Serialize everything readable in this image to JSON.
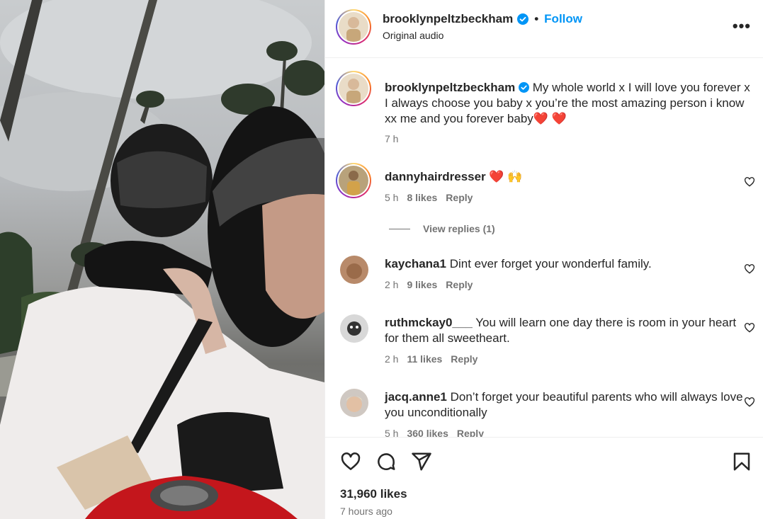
{
  "post": {
    "username": "brooklynpeltzbeckham",
    "follow_label": "Follow",
    "separator": "•",
    "audio": "Original audio",
    "more_label": "•••"
  },
  "caption": {
    "username": "brooklynpeltzbeckham",
    "text": "My whole world x I will love you forever x I always choose you baby x you’re the most amazing person i know xx me and you forever baby❤️ ❤️",
    "time": "7 h"
  },
  "comments": [
    {
      "username": "dannyhairdresser",
      "text": "❤️ 🙌",
      "time": "5 h",
      "likes": "8 likes",
      "reply": "Reply"
    },
    {
      "username": "kaychana1",
      "text": "Dint ever forget your wonderful family.",
      "time": "2 h",
      "likes": "9 likes",
      "reply": "Reply"
    },
    {
      "username": "ruthmckay0___",
      "text": "You will learn one day there is room in your heart for them all sweetheart.",
      "time": "2 h",
      "likes": "11 likes",
      "reply": "Reply"
    },
    {
      "username": "jacq.anne1",
      "text": "Don’t forget your beautiful parents who will always love you unconditionally",
      "time": "5 h",
      "likes": "360 likes",
      "reply": "Reply"
    }
  ],
  "view_replies": "View replies (1)",
  "footer": {
    "likes": "31,960 likes",
    "time": "7 hours ago"
  },
  "icons": {
    "verified": "verified-badge-icon",
    "like": "heart-icon",
    "comment": "comment-icon",
    "share": "share-icon",
    "save": "bookmark-icon"
  },
  "colors": {
    "accent": "#0095f6",
    "text": "#262626",
    "muted": "#737373",
    "verified": "#0095f6"
  }
}
